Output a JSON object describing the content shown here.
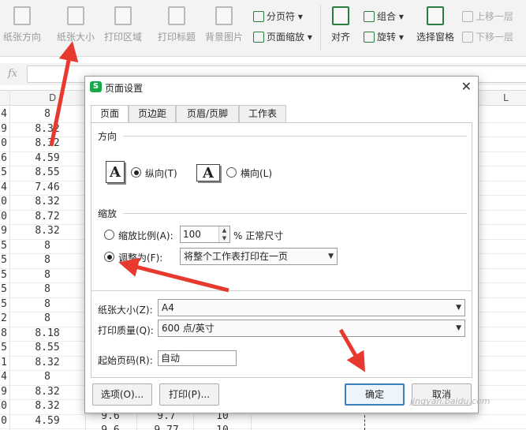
{
  "ribbon": {
    "big_buttons": [
      "纸张方向",
      "纸张大小",
      "打印区域",
      "打印标题",
      "背景图片"
    ],
    "small_buttons": {
      "page_break": "分页符",
      "page_zoom": "页面缩放",
      "align": "对齐",
      "group": "组合",
      "rotate": "旋转",
      "selection_pane": "选择窗格",
      "bring_forward": "上移一层",
      "send_backward": "下移一层"
    }
  },
  "formula_bar": {
    "fx": "fx"
  },
  "sheet": {
    "col_d": "D",
    "col_l": "L",
    "row_prefix": [
      "4",
      "9",
      "0",
      "6",
      "5",
      "4",
      "0",
      "0",
      "9",
      "5",
      "5",
      "5",
      "5",
      "5",
      "2",
      "8",
      "5",
      "1",
      "4",
      "9",
      "0",
      "0"
    ],
    "col_d_values": [
      "8",
      "8.32",
      "8.32",
      "4.59",
      "8.55",
      "7.46",
      "8.32",
      "8.72",
      "8.32",
      "8",
      "8",
      "8",
      "8",
      "8",
      "8",
      "8.18",
      "8.55",
      "8.32",
      "8",
      "8.32",
      "8.32",
      "4.59"
    ],
    "bottom_rows": [
      [
        "9.6",
        "9.7",
        "10"
      ],
      [
        "9.6",
        "9.77",
        "10"
      ]
    ]
  },
  "dialog": {
    "title": "页面设置",
    "tabs": [
      "页面",
      "页边距",
      "页眉/页脚",
      "工作表"
    ],
    "orientation": {
      "group_label": "方向",
      "portrait_icon": "A",
      "portrait_label": "纵向(T)",
      "landscape_icon": "A",
      "landscape_label": "横向(L)",
      "selected": "portrait"
    },
    "scaling": {
      "group_label": "缩放",
      "scale_label": "缩放比例(A):",
      "scale_value": "100",
      "scale_unit": "% 正常尺寸",
      "fit_label": "调整为(F):",
      "fit_option": "将整个工作表打印在一页",
      "selected": "fit"
    },
    "paper_size_label": "纸张大小(Z):",
    "paper_size_value": "A4",
    "print_quality_label": "打印质量(Q):",
    "print_quality_value": "600 点/英寸",
    "first_page_label": "起始页码(R):",
    "first_page_value": "自动",
    "buttons": {
      "options": "选项(O)...",
      "print": "打印(P)...",
      "ok": "确定",
      "cancel": "取消"
    }
  },
  "watermark": "jingyan.baidu.com",
  "colors": {
    "accent": "#3c7fc1",
    "arrow": "#e8392e",
    "wps_green": "#18a84a"
  }
}
